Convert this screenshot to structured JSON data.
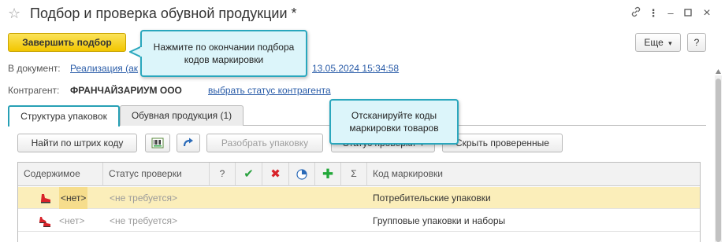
{
  "window": {
    "title": "Подбор и проверка обувной продукции *",
    "favorite_icon": "star-icon",
    "buttons": {
      "link": "link-icon",
      "menu": "more-icon",
      "minimize": "minimize-icon",
      "maximize": "maximize-icon",
      "close": "close-icon"
    }
  },
  "toolbar": {
    "finish_label": "Завершить подбор",
    "more_label": "Еще",
    "more_arrow": "▾",
    "help_label": "?"
  },
  "document_row": {
    "label": "В документ:",
    "link_start": "Реализация (ак",
    "link_end": "13.05.2024 15:34:58"
  },
  "contractor_row": {
    "label": "Контрагент:",
    "name": "ФРАНЧАЙЗАРИУМ ООО",
    "status_link": "выбрать статус контрагента"
  },
  "tabs": [
    {
      "label": "Структура упаковок",
      "active": true
    },
    {
      "label": "Обувная продукция (1)",
      "active": false
    }
  ],
  "table_toolbar": {
    "find_barcode": "Найти по штрих коду",
    "unpack": "Разобрать упаковку",
    "check_status": "Статус проверки",
    "check_status_arrow": "▾",
    "hide_checked": "Скрыть проверенные"
  },
  "table": {
    "headers": {
      "content": "Содержимое",
      "status": "Статус проверки",
      "question": "?",
      "sigma": "Σ",
      "code": "Код маркировки"
    },
    "rows": [
      {
        "content": "<нет>",
        "status": "<не требуется>",
        "code": "Потребительские упаковки",
        "selected": true
      },
      {
        "content": "<нет>",
        "status": "<не требуется>",
        "code": "Групповые упаковки и наборы",
        "selected": false
      }
    ]
  },
  "callouts": {
    "finish_hint": "Нажмите по окончании подбора кодов маркировки",
    "scan_hint": "Отсканируйте коды маркировки товаров"
  },
  "colors": {
    "accent_yellow": "#f2c600",
    "callout_border": "#2aa7bd",
    "callout_fill": "#dcf5fa",
    "link": "#2a5ca8",
    "selected_row": "#fbeeba",
    "check_green": "#2aa13f",
    "cross_red": "#d8232a",
    "plus_green": "#22a83a"
  }
}
